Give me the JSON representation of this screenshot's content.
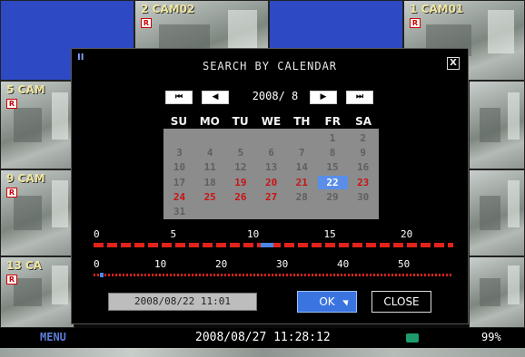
{
  "dialog": {
    "title": "SEARCH BY CALENDAR",
    "grip": "II",
    "close_x": "X",
    "month_label": "2008/ 8",
    "nav": {
      "first": "⏮",
      "prev": "◀",
      "next": "▶",
      "last": "⏭"
    },
    "weekdays": [
      "SU",
      "MO",
      "TU",
      "WE",
      "TH",
      "FR",
      "SA"
    ],
    "selected_day": 22,
    "days": [
      {
        "d": 1,
        "red": false
      },
      {
        "d": 2,
        "red": false
      },
      {
        "d": 3,
        "red": false
      },
      {
        "d": 4,
        "red": false
      },
      {
        "d": 5,
        "red": false
      },
      {
        "d": 6,
        "red": false
      },
      {
        "d": 7,
        "red": false
      },
      {
        "d": 8,
        "red": false
      },
      {
        "d": 9,
        "red": false
      },
      {
        "d": 10,
        "red": false
      },
      {
        "d": 11,
        "red": false
      },
      {
        "d": 12,
        "red": false
      },
      {
        "d": 13,
        "red": false
      },
      {
        "d": 14,
        "red": false
      },
      {
        "d": 15,
        "red": false
      },
      {
        "d": 16,
        "red": false
      },
      {
        "d": 17,
        "red": false
      },
      {
        "d": 18,
        "red": false
      },
      {
        "d": 19,
        "red": true
      },
      {
        "d": 20,
        "red": true
      },
      {
        "d": 21,
        "red": true
      },
      {
        "d": 22,
        "red": true
      },
      {
        "d": 23,
        "red": true
      },
      {
        "d": 24,
        "red": true
      },
      {
        "d": 25,
        "red": true
      },
      {
        "d": 26,
        "red": true
      },
      {
        "d": 27,
        "red": true
      },
      {
        "d": 28,
        "red": false
      },
      {
        "d": 29,
        "red": false
      },
      {
        "d": 30,
        "red": false
      },
      {
        "d": 31,
        "red": false
      }
    ],
    "hour_ticks": [
      "0",
      "5",
      "10",
      "15",
      "20"
    ],
    "minute_ticks": [
      "0",
      "10",
      "20",
      "30",
      "40",
      "50"
    ],
    "datetime_value": "2008/08/22 11:01",
    "ok_label": "OK",
    "close_label": "CLOSE"
  },
  "cameras": [
    {
      "label": "2 CAM02"
    },
    {
      "label": "1 CAM01"
    },
    {
      "label": "5 CAM"
    },
    {
      "label": "9 CAM"
    },
    {
      "label": "13 CA"
    }
  ],
  "status": {
    "menu": "MENU",
    "clock": "2008/08/27 11:28:12",
    "hdd_percent": "99%"
  },
  "colors": {
    "accent": "#3a74e0",
    "record": "#e2231a",
    "grid": "#8c8c8c"
  }
}
